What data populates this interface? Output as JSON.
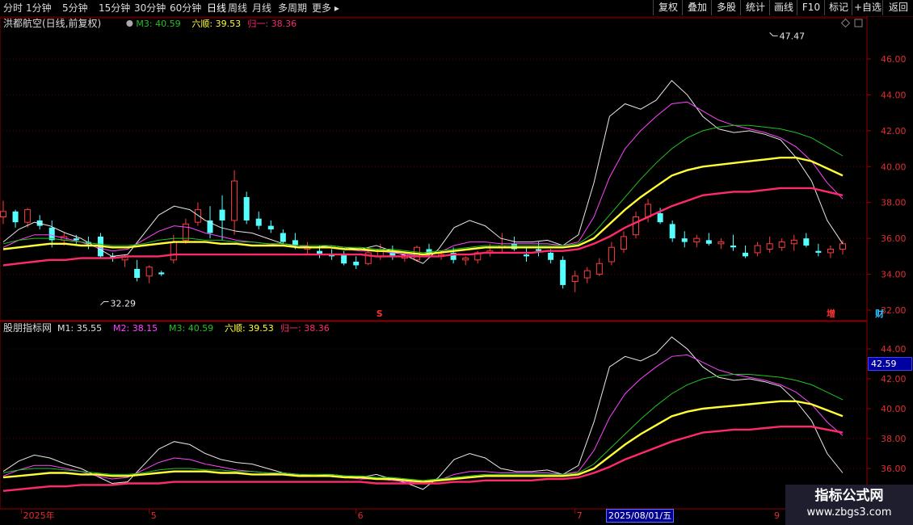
{
  "toolbar": {
    "periods": [
      "分时",
      "1分钟",
      "5分钟",
      "15分钟",
      "30分钟",
      "60分钟",
      "日线",
      "周线",
      "月线",
      "多周期",
      "更多"
    ],
    "active_period": "日线",
    "actions": [
      "复权",
      "叠加",
      "多股",
      "统计",
      "画线",
      "F10",
      "标记",
      "+自选",
      "返回"
    ]
  },
  "main_legend": {
    "title": "洪都航空(日线,前复权)",
    "items": [
      {
        "label": "M3: 40.59",
        "color": "#22c322"
      },
      {
        "label": "六顺: 39.53",
        "color": "#ffff33"
      },
      {
        "label": "归一: 38.36",
        "color": "#ff2a6a"
      }
    ]
  },
  "sub_legend": {
    "title": "股朋指标网",
    "items": [
      {
        "label": "M1: 35.55",
        "color": "#e0e0e0"
      },
      {
        "label": "M2: 38.15",
        "color": "#ff44ff"
      },
      {
        "label": "M3: 40.59",
        "color": "#22c322"
      },
      {
        "label": "六顺: 39.53",
        "color": "#ffff33"
      },
      {
        "label": "归一: 38.36",
        "color": "#ff2a6a"
      }
    ]
  },
  "chart_data": [
    {
      "type": "candlestick",
      "ylim": [
        31.5,
        48
      ],
      "yticks": [
        "46.00",
        "44.00",
        "42.00",
        "40.00",
        "38.00",
        "36.00",
        "34.00",
        "32.00"
      ],
      "ytick_values": [
        46,
        44,
        42,
        40,
        38,
        36,
        34,
        32
      ],
      "annotations": [
        {
          "text": "47.47",
          "x": 63,
          "y": 47.47
        },
        {
          "text": "32.29",
          "x": 8,
          "y": 32.29
        }
      ],
      "markers": [
        {
          "text": "S",
          "x": 31,
          "color": "#ff3030"
        },
        {
          "text": "增",
          "x": 68,
          "color": "#ff3030"
        },
        {
          "text": "财",
          "x": 72,
          "color": "#30c0ff"
        }
      ],
      "candles": [
        [
          37.2,
          38.1,
          36.8,
          37.5
        ],
        [
          37.5,
          37.6,
          36.6,
          36.9
        ],
        [
          36.9,
          37.7,
          36.6,
          37.6
        ],
        [
          37.0,
          37.3,
          36.5,
          36.7
        ],
        [
          36.6,
          37.0,
          35.5,
          35.9
        ],
        [
          35.9,
          36.3,
          35.6,
          36.1
        ],
        [
          36.0,
          36.2,
          35.7,
          35.9
        ],
        [
          35.8,
          36.1,
          35.4,
          35.7
        ],
        [
          36.1,
          36.3,
          34.9,
          35.0
        ],
        [
          35.0,
          35.2,
          34.7,
          34.9
        ],
        [
          34.8,
          35.1,
          34.4,
          35.0
        ],
        [
          34.3,
          34.8,
          33.6,
          33.8
        ],
        [
          33.9,
          34.5,
          33.5,
          34.4
        ],
        [
          34.1,
          34.2,
          33.9,
          34.0
        ],
        [
          34.8,
          36.2,
          34.6,
          35.8
        ],
        [
          35.9,
          37.1,
          35.7,
          36.8
        ],
        [
          36.9,
          38.0,
          36.7,
          37.6
        ],
        [
          37.0,
          37.8,
          36.0,
          36.3
        ],
        [
          37.6,
          38.4,
          35.9,
          37.0
        ],
        [
          37.0,
          39.8,
          36.2,
          39.2
        ],
        [
          38.3,
          38.6,
          36.8,
          37.0
        ],
        [
          37.1,
          37.5,
          36.5,
          36.7
        ],
        [
          36.7,
          37.0,
          36.3,
          36.5
        ],
        [
          36.3,
          36.5,
          35.7,
          35.8
        ],
        [
          35.9,
          36.3,
          35.4,
          35.6
        ],
        [
          35.4,
          35.8,
          35.1,
          35.5
        ],
        [
          35.3,
          35.6,
          34.9,
          35.1
        ],
        [
          35.1,
          35.4,
          34.8,
          35.0
        ],
        [
          35.1,
          35.3,
          34.5,
          34.6
        ],
        [
          34.7,
          35.0,
          34.3,
          34.5
        ],
        [
          34.6,
          35.5,
          34.5,
          35.2
        ],
        [
          35.0,
          35.7,
          34.8,
          35.4
        ],
        [
          35.3,
          35.6,
          34.8,
          35.0
        ],
        [
          34.9,
          35.2,
          34.7,
          35.1
        ],
        [
          34.8,
          35.6,
          34.7,
          35.5
        ],
        [
          35.4,
          35.7,
          35.0,
          35.1
        ],
        [
          35.0,
          35.3,
          34.8,
          35.1
        ],
        [
          35.2,
          35.5,
          34.6,
          34.8
        ],
        [
          34.8,
          35.0,
          34.5,
          34.9
        ],
        [
          34.8,
          35.3,
          34.6,
          35.2
        ],
        [
          35.2,
          35.7,
          35.0,
          35.3
        ],
        [
          35.5,
          36.3,
          35.2,
          35.6
        ],
        [
          35.7,
          36.1,
          35.3,
          35.4
        ],
        [
          35.1,
          35.5,
          34.7,
          35.0
        ],
        [
          35.4,
          35.8,
          35.0,
          35.3
        ],
        [
          35.2,
          35.4,
          34.6,
          34.8
        ],
        [
          34.8,
          35.0,
          33.2,
          33.4
        ],
        [
          33.6,
          34.2,
          33.0,
          33.9
        ],
        [
          33.8,
          34.4,
          33.5,
          34.2
        ],
        [
          34.0,
          34.9,
          33.9,
          34.6
        ],
        [
          34.7,
          35.8,
          34.5,
          35.5
        ],
        [
          35.4,
          36.4,
          35.2,
          36.1
        ],
        [
          36.2,
          37.5,
          36.0,
          37.2
        ],
        [
          37.2,
          38.2,
          36.9,
          37.9
        ],
        [
          37.4,
          37.7,
          36.8,
          36.9
        ],
        [
          36.8,
          37.0,
          35.8,
          36.0
        ],
        [
          36.0,
          36.4,
          35.5,
          35.8
        ],
        [
          35.8,
          36.2,
          35.5,
          36.0
        ],
        [
          35.9,
          36.3,
          35.6,
          35.7
        ],
        [
          35.7,
          36.0,
          35.4,
          35.8
        ],
        [
          35.6,
          36.2,
          35.3,
          35.5
        ],
        [
          35.2,
          35.6,
          34.9,
          35.0
        ],
        [
          35.2,
          35.8,
          35.0,
          35.6
        ],
        [
          35.4,
          36.1,
          35.2,
          35.7
        ],
        [
          35.5,
          36.0,
          35.3,
          35.8
        ],
        [
          35.7,
          36.2,
          35.3,
          35.9
        ],
        [
          36.0,
          36.3,
          35.5,
          35.6
        ],
        [
          35.3,
          35.7,
          35.0,
          35.2
        ],
        [
          35.2,
          35.6,
          34.9,
          35.4
        ],
        [
          35.4,
          35.9,
          35.1,
          35.7
        ]
      ]
    },
    {
      "type": "line",
      "ylim": [
        34.9,
        45.6
      ],
      "yticks": [
        "44.00",
        "42.00",
        "40.00",
        "38.00",
        "36.00"
      ],
      "ytick_values": [
        44,
        42,
        40,
        38,
        36
      ],
      "crosshair_value": "42.59",
      "series": [
        {
          "name": "M1",
          "color": "#e8e8e8",
          "width": 1,
          "values": [
            35.8,
            36.5,
            36.9,
            36.7,
            36.3,
            36.0,
            35.5,
            35.0,
            35.1,
            36.2,
            37.3,
            37.8,
            37.6,
            37.0,
            36.6,
            36.4,
            36.3,
            36.0,
            35.7,
            35.6,
            35.5,
            35.6,
            35.5,
            35.4,
            35.6,
            35.3,
            35.0,
            34.6,
            35.4,
            36.6,
            37.0,
            36.7,
            36.0,
            35.8,
            35.8,
            35.9,
            35.6,
            36.2,
            39.1,
            42.8,
            43.5,
            43.2,
            43.7,
            44.8,
            44.0,
            42.8,
            42.1,
            41.9,
            42.0,
            41.8,
            41.5,
            40.5,
            39.2,
            37.0,
            35.7
          ]
        },
        {
          "name": "M2",
          "color": "#ff44ff",
          "width": 1,
          "values": [
            35.5,
            35.9,
            36.2,
            36.2,
            36.0,
            35.8,
            35.5,
            35.3,
            35.4,
            35.9,
            36.4,
            36.7,
            36.6,
            36.3,
            36.1,
            35.9,
            35.8,
            35.7,
            35.6,
            35.6,
            35.5,
            35.5,
            35.4,
            35.3,
            35.3,
            35.2,
            35.1,
            35.0,
            35.2,
            35.6,
            35.8,
            35.8,
            35.7,
            35.7,
            35.7,
            35.7,
            35.6,
            35.8,
            37.2,
            39.4,
            41.0,
            42.0,
            42.8,
            43.5,
            43.6,
            43.1,
            42.6,
            42.3,
            42.1,
            41.9,
            41.6,
            41.1,
            40.3,
            39.1,
            38.2
          ]
        },
        {
          "name": "M3",
          "color": "#22c322",
          "width": 1,
          "values": [
            35.7,
            35.9,
            36.0,
            36.0,
            35.9,
            35.8,
            35.7,
            35.6,
            35.6,
            35.7,
            35.9,
            36.0,
            36.0,
            35.9,
            35.9,
            35.8,
            35.8,
            35.7,
            35.7,
            35.6,
            35.6,
            35.6,
            35.5,
            35.5,
            35.4,
            35.4,
            35.3,
            35.2,
            35.3,
            35.4,
            35.5,
            35.6,
            35.6,
            35.6,
            35.6,
            35.6,
            35.6,
            35.7,
            36.3,
            37.3,
            38.3,
            39.3,
            40.2,
            41.0,
            41.6,
            42.0,
            42.2,
            42.3,
            42.3,
            42.2,
            42.1,
            41.9,
            41.6,
            41.1,
            40.6
          ]
        },
        {
          "name": "六顺",
          "color": "#ffff33",
          "width": 2.4,
          "values": [
            35.4,
            35.5,
            35.6,
            35.7,
            35.7,
            35.6,
            35.6,
            35.5,
            35.5,
            35.6,
            35.7,
            35.8,
            35.8,
            35.8,
            35.7,
            35.7,
            35.6,
            35.6,
            35.6,
            35.5,
            35.5,
            35.5,
            35.4,
            35.4,
            35.3,
            35.3,
            35.2,
            35.1,
            35.2,
            35.3,
            35.4,
            35.5,
            35.5,
            35.5,
            35.5,
            35.5,
            35.5,
            35.6,
            36.0,
            36.8,
            37.6,
            38.3,
            38.9,
            39.5,
            39.8,
            40.0,
            40.1,
            40.2,
            40.3,
            40.4,
            40.5,
            40.5,
            40.3,
            39.9,
            39.5
          ]
        },
        {
          "name": "归一",
          "color": "#ff2a6a",
          "width": 2.4,
          "values": [
            34.5,
            34.6,
            34.7,
            34.8,
            34.8,
            34.9,
            34.9,
            34.9,
            35.0,
            35.0,
            35.0,
            35.1,
            35.1,
            35.1,
            35.1,
            35.1,
            35.1,
            35.1,
            35.1,
            35.1,
            35.1,
            35.1,
            35.1,
            35.1,
            35.0,
            35.0,
            35.0,
            35.0,
            35.0,
            35.1,
            35.1,
            35.2,
            35.2,
            35.2,
            35.2,
            35.3,
            35.3,
            35.4,
            35.7,
            36.1,
            36.6,
            37.0,
            37.4,
            37.8,
            38.1,
            38.4,
            38.5,
            38.6,
            38.6,
            38.7,
            38.8,
            38.8,
            38.8,
            38.6,
            38.4
          ]
        }
      ]
    }
  ],
  "xaxis": {
    "labels": [
      {
        "text": "2025年",
        "x": 1.5
      },
      {
        "text": "5",
        "x": 12
      },
      {
        "text": "6",
        "x": 29
      },
      {
        "text": "7",
        "x": 47
      }
    ],
    "selected_date": "2025/08/01/五",
    "right_label": "9"
  },
  "tooltip_value": "42.59",
  "watermark": {
    "line1": "指标公式网",
    "line2": "www.zbgs3.com"
  }
}
